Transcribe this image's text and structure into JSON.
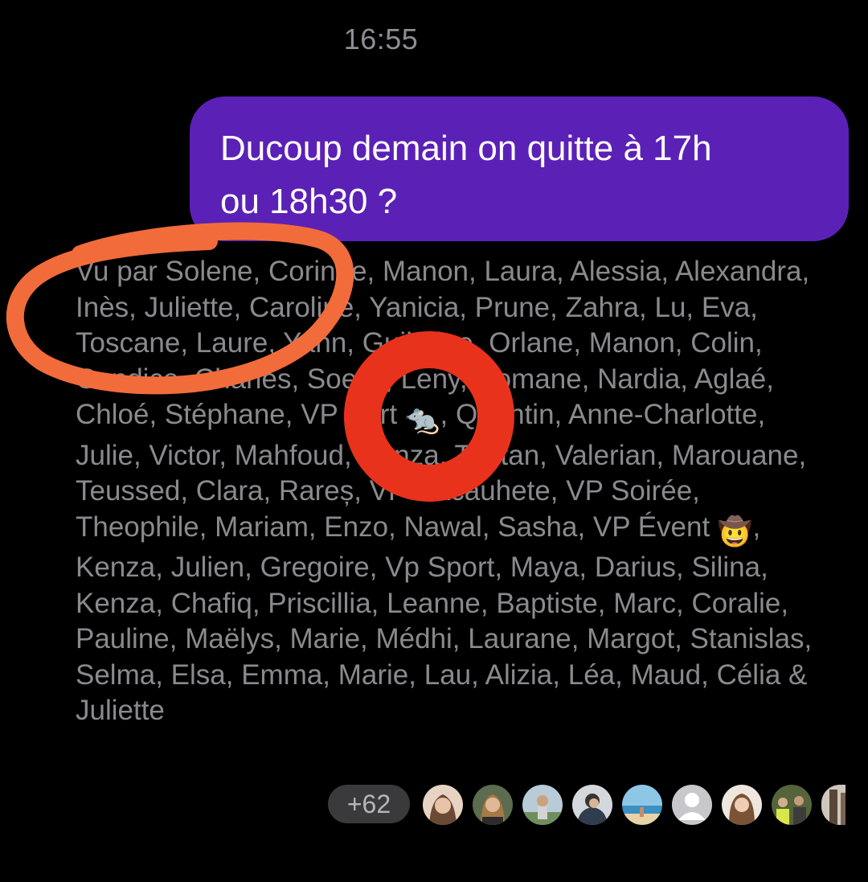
{
  "header": {
    "timestamp": "16:55"
  },
  "message": {
    "line1": "Ducoup demain on quitte à 17h",
    "line2": "ou 18h30 ?",
    "bubble_color": "#5b21b6"
  },
  "seen_by": {
    "part1": "Vu par Solene, Corinne, Manon, Laura, Alessia, Alexandra, Inès, Juliette, Caroline, Yanicia, Prune, Zahra, Lu, Eva, Toscane, Laure, Yann, Guilmine, Orlane, Manon, Colin, Candice, Charles, Soelie, Leny, Romane, Nardia, Aglaé, Chloé, Stéphane, VP Part ",
    "emoji1": "🐀",
    "part2": ", Quentin, Anne-Charlotte, Julie, Victor, Mahfoud, Kenza, Tristan, Valerian, Marouane, Teussed, Clara, Rareș, VP Cacauhete, VP Soirée, Theophile, Mariam, Enzo, Nawal, Sasha, VP Évent ",
    "emoji2": "🤠",
    "part3": ", Kenza, Julien, Gregoire, Vp Sport, Maya, Darius, Silina, Kenza, Chafiq, Priscillia, Leanne, Baptiste, Marc, Coralie, Pauline, Maëlys, Marie, Médhi, Laurane, Margot, Stanislas, Selma, Elsa, Emma, Marie, Lau, Alizia, Léa, Maud, Célia & Juliette"
  },
  "reactions": {
    "more_count": "+62",
    "avatars": [
      {
        "icon": "person-photo-icon",
        "color": "#c9a48c"
      },
      {
        "icon": "person-photo-icon",
        "color": "#8f7a5e"
      },
      {
        "icon": "person-photo-icon",
        "color": "#9fb2a0"
      },
      {
        "icon": "person-photo-icon",
        "color": "#6f7d86"
      },
      {
        "icon": "beach-photo-icon",
        "color": "#7fb6d6"
      },
      {
        "icon": "default-avatar-icon",
        "color": "#8e8e93"
      },
      {
        "icon": "person-photo-icon",
        "color": "#d9c1b0"
      },
      {
        "icon": "group-photo-icon",
        "color": "#7e8a4a"
      },
      {
        "icon": "person-photo-icon",
        "color": "#a08a74"
      }
    ]
  },
  "annotations": {
    "orange_loop_color": "#f26b3a",
    "red_ring_color": "#e8321c"
  }
}
